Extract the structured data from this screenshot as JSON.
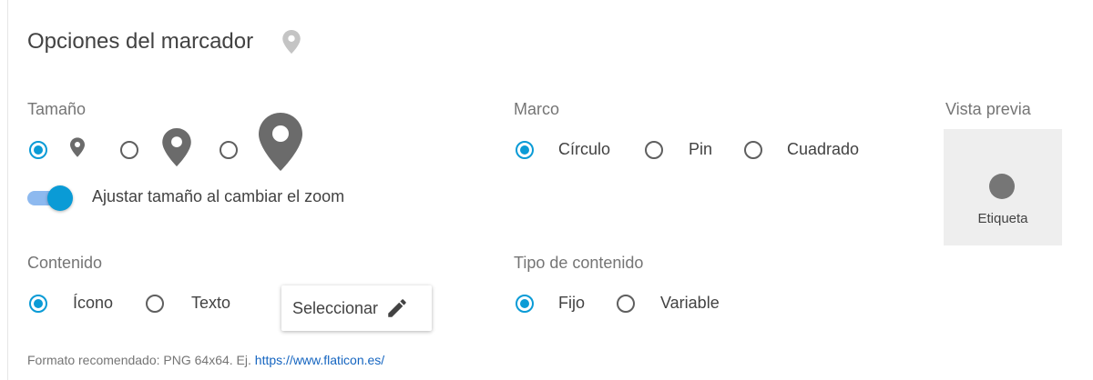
{
  "title": "Opciones del marcador",
  "icons": {
    "title_pin": "location-pin-icon",
    "edit": "pencil-icon"
  },
  "colors": {
    "accent": "#0a9bd6",
    "pin": "#6b6b6b",
    "title_pin": "#c4c4c4",
    "link": "#1565c0"
  },
  "size": {
    "label": "Tamaño",
    "options": [
      "small",
      "medium",
      "large"
    ],
    "selected": "small"
  },
  "zoom_toggle": {
    "label": "Ajustar tamaño al cambiar el zoom",
    "on": true
  },
  "frame": {
    "label": "Marco",
    "options": [
      "Círculo",
      "Pin",
      "Cuadrado"
    ],
    "selected": "Círculo"
  },
  "preview": {
    "label": "Vista previa",
    "marker_label": "Etiqueta"
  },
  "content": {
    "label": "Contenido",
    "options": [
      "Ícono",
      "Texto"
    ],
    "selected": "Ícono",
    "select_button": "Seleccionar"
  },
  "content_type": {
    "label": "Tipo de contenido",
    "options": [
      "Fijo",
      "Variable"
    ],
    "selected": "Fijo"
  },
  "footer": {
    "text": "Formato recomendado: PNG 64x64. Ej.",
    "link": "https://www.flaticon.es/"
  }
}
